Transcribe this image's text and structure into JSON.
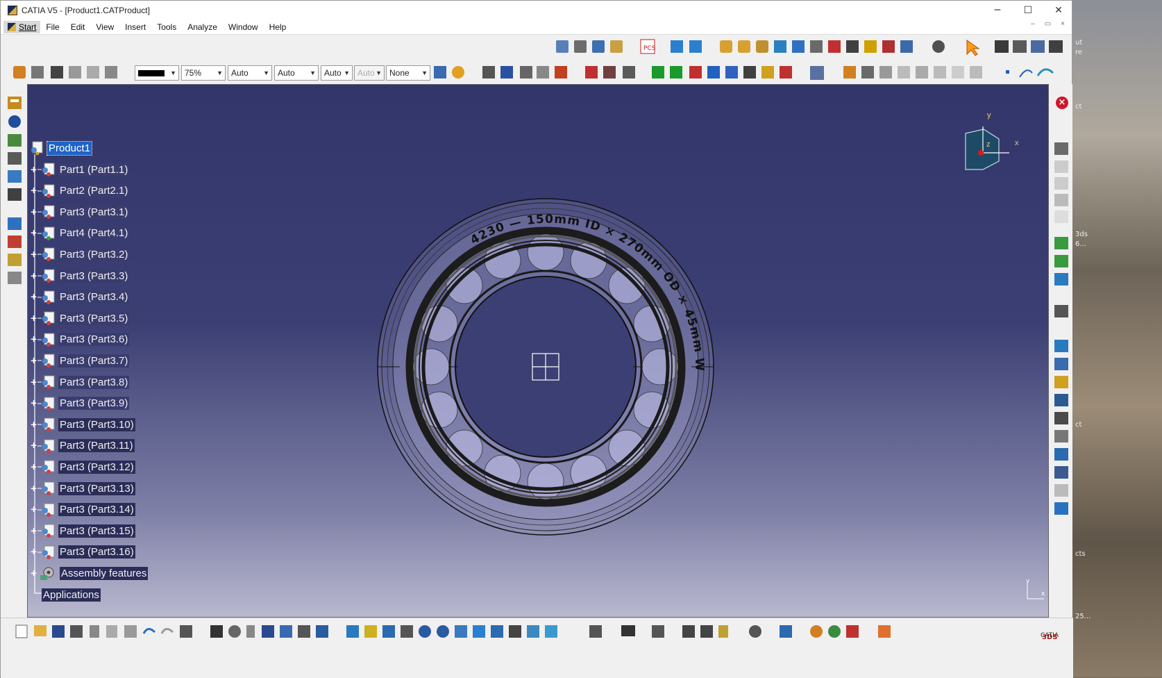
{
  "window": {
    "title": "CATIA V5 - [Product1.CATProduct]",
    "minimize": "─",
    "maximize": "☐",
    "close": "✕",
    "mdi_minimize": "–",
    "mdi_restore": "▭",
    "mdi_close": "×"
  },
  "menu": {
    "items": [
      "Start",
      "File",
      "Edit",
      "View",
      "Insert",
      "Tools",
      "Analyze",
      "Window",
      "Help"
    ]
  },
  "graphic_properties": {
    "line_color": "#000000",
    "transparency": "75%",
    "thickness": "Auto",
    "linetype": "Auto",
    "point_type": "Auto",
    "layer_disabled": "Auto",
    "layer": "None"
  },
  "spec_tree": {
    "root": "Product1",
    "parts": [
      "Part1 (Part1.1)",
      "Part2 (Part2.1)",
      "Part3 (Part3.1)",
      "Part4 (Part4.1)",
      "Part3 (Part3.2)",
      "Part3 (Part3.3)",
      "Part3 (Part3.4)",
      "Part3 (Part3.5)",
      "Part3 (Part3.6)",
      "Part3 (Part3.7)",
      "Part3 (Part3.8)",
      "Part3 (Part3.9)",
      "Part3 (Part3.10)",
      "Part3 (Part3.11)",
      "Part3 (Part3.12)",
      "Part3 (Part3.13)",
      "Part3 (Part3.14)",
      "Part3 (Part3.15)",
      "Part3 (Part3.16)"
    ],
    "assembly_features": "Assembly features",
    "applications": "Applications"
  },
  "model": {
    "engraving": "4230 — 150mm ID × 270mm OD × 45mm W"
  },
  "compass": {
    "x": "x",
    "y": "y",
    "z": "z"
  },
  "mini_axis": {
    "x": "x",
    "y": "y"
  },
  "brand": "CATIA",
  "desktop_labels": [
    "ut",
    "re",
    "ct",
    "3ds",
    "6...",
    "ct",
    "cts",
    "25..."
  ],
  "icons": {
    "toolbar_row1": [
      "mouse-pointer-icon"
    ],
    "toolbar_row2": [
      "line-weight-icon"
    ],
    "left": [
      "spec-tree-icon"
    ],
    "right": [
      "close-red-icon"
    ]
  },
  "colors": {
    "viewport_top": "#33366a",
    "viewport_bottom": "#b9b8cf",
    "selection": "#1e63c8"
  }
}
